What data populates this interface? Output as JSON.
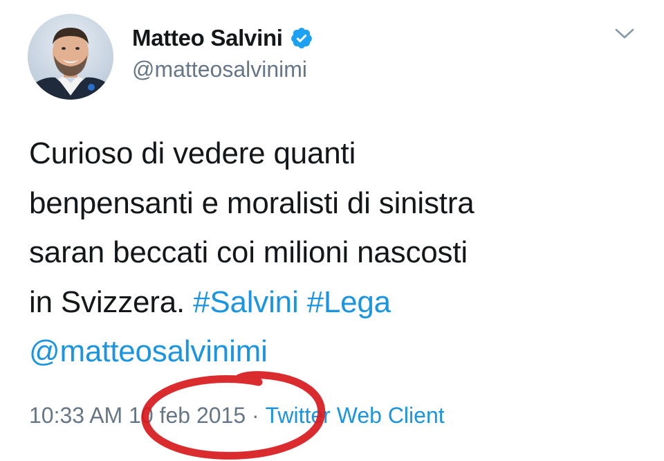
{
  "tweet": {
    "author": {
      "display_name": "Matteo Salvini",
      "handle": "@matteosalvinimi",
      "verified": true,
      "avatar_icon": "profile-photo"
    },
    "text_lines": [
      "Curioso di vedere quanti",
      "benpensanti e moralisti di sinistra",
      "saran beccati coi milioni nascosti"
    ],
    "last_line_prefix": "in Svizzera. ",
    "hashtags": [
      "#Salvini",
      "#Lega"
    ],
    "mention": "@matteosalvinimi",
    "time": "10:33 AM",
    "separator": " · ",
    "date": "10 feb 2015",
    "source": "Twitter Web Client"
  },
  "colors": {
    "text": "#14171a",
    "secondary": "#657786",
    "link": "#1b95e0",
    "verified_badge": "#1da1f2",
    "annotation_circle": "#d7191c"
  },
  "icons": {
    "menu_caret": "chevron-down-icon",
    "verified": "verified-badge-icon"
  }
}
